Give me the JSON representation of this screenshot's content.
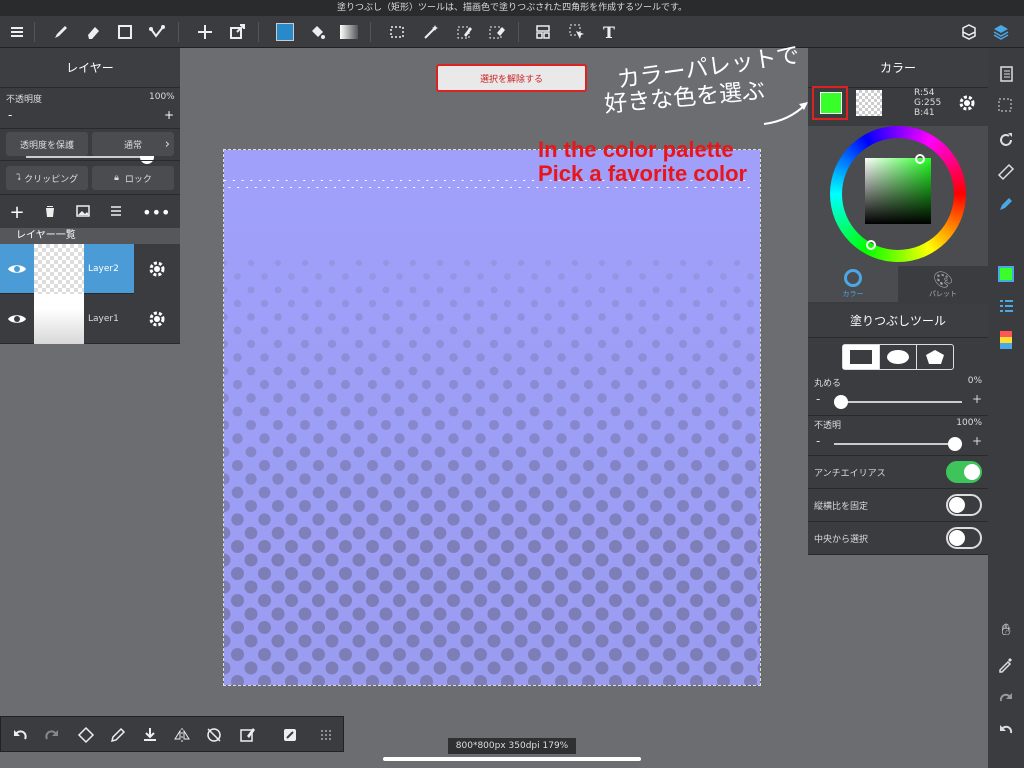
{
  "top_message": "塗りつぶし（矩形）ツールは、描画色で塗りつぶされた四角形を作成するツールです。",
  "toolbar": {
    "icons": [
      "menu-icon",
      "brush-icon",
      "eraser-icon",
      "rect-shape-icon",
      "connect-icon",
      "move-icon",
      "transform-icon",
      "color-swatch",
      "fill-bucket-icon",
      "gradient-icon",
      "select-rect-icon",
      "magic-wand-icon",
      "select-pen-icon",
      "select-eraser-icon",
      "layout-icon",
      "select-arrow-icon",
      "text-icon",
      "materials-icon",
      "layers-icon"
    ],
    "text_label": "T"
  },
  "layers_panel": {
    "title": "レイヤー",
    "opacity_label": "不透明度",
    "opacity_value": "100%",
    "opacity_fraction": 1.0,
    "minus": "-",
    "plus": "+",
    "protect_alpha": "透明度を保護",
    "blend_mode": "通常",
    "clipping": "クリッピング",
    "lock": "ロック",
    "list_header": "レイヤー一覧",
    "layers": [
      {
        "name": "Layer2",
        "selected": true
      },
      {
        "name": "Layer1",
        "selected": false
      }
    ]
  },
  "deselect_button": "選択を解除する",
  "color_panel": {
    "title": "カラー",
    "r": "R:54",
    "g": "G:255",
    "b": "B:41",
    "current_color": "#36ff29",
    "tab_color": "カラー",
    "tab_palette": "パレット"
  },
  "fill_tool_panel": {
    "title": "塗りつぶしツール",
    "round_label": "丸める",
    "round_value": "0%",
    "round_fraction": 0.0,
    "opacity_label": "不透明",
    "opacity_value": "100%",
    "opacity_fraction": 1.0,
    "antialias_label": "アンチエイリアス",
    "antialias_on": true,
    "aspect_label": "縦横比を固定",
    "aspect_on": false,
    "center_label": "中央から選択",
    "center_on": false,
    "minus": "-",
    "plus": "+"
  },
  "annotation": {
    "handwritten_line1": "カラーパレットで",
    "handwritten_line2": "好きな色を選ぶ",
    "red_line1": "In the color palette",
    "red_line2": "Pick a favorite color"
  },
  "status": "800*800px 350dpi 179%",
  "colors": {
    "canvas_top": "#a0a0fb",
    "canvas_bottom": "#9a9cf0",
    "dot": "#7d7eb8",
    "accent_blue": "#4a9bd6",
    "toggle_green": "#3ec45a"
  }
}
